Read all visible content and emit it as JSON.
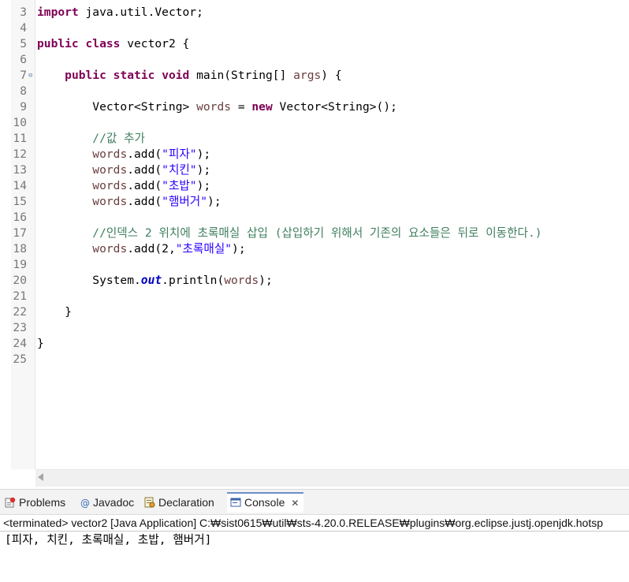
{
  "editor": {
    "lines": [
      {
        "num": "3",
        "tokens": [
          {
            "t": "import",
            "c": "kw"
          },
          {
            "t": " java.util.Vector;"
          }
        ]
      },
      {
        "num": "4",
        "tokens": []
      },
      {
        "num": "5",
        "tokens": [
          {
            "t": "public",
            "c": "kw"
          },
          {
            "t": " "
          },
          {
            "t": "class",
            "c": "kw"
          },
          {
            "t": " vector2 {"
          }
        ]
      },
      {
        "num": "6",
        "tokens": []
      },
      {
        "num": "7",
        "fold": true,
        "tokens": [
          {
            "t": "    "
          },
          {
            "t": "public",
            "c": "kw"
          },
          {
            "t": " "
          },
          {
            "t": "static",
            "c": "kw"
          },
          {
            "t": " "
          },
          {
            "t": "void",
            "c": "kw"
          },
          {
            "t": " main(String[] "
          },
          {
            "t": "args",
            "c": "var"
          },
          {
            "t": ") {"
          }
        ]
      },
      {
        "num": "8",
        "tokens": []
      },
      {
        "num": "9",
        "tokens": [
          {
            "t": "        Vector<String> "
          },
          {
            "t": "words",
            "c": "var"
          },
          {
            "t": " = "
          },
          {
            "t": "new",
            "c": "kw"
          },
          {
            "t": " Vector<String>();"
          }
        ]
      },
      {
        "num": "10",
        "tokens": []
      },
      {
        "num": "11",
        "tokens": [
          {
            "t": "        "
          },
          {
            "t": "//값 추가",
            "c": "cmt"
          }
        ]
      },
      {
        "num": "12",
        "tokens": [
          {
            "t": "        "
          },
          {
            "t": "words",
            "c": "var"
          },
          {
            "t": ".add("
          },
          {
            "t": "\"피자\"",
            "c": "str"
          },
          {
            "t": ");"
          }
        ]
      },
      {
        "num": "13",
        "tokens": [
          {
            "t": "        "
          },
          {
            "t": "words",
            "c": "var"
          },
          {
            "t": ".add("
          },
          {
            "t": "\"치킨\"",
            "c": "str"
          },
          {
            "t": ");"
          }
        ]
      },
      {
        "num": "14",
        "tokens": [
          {
            "t": "        "
          },
          {
            "t": "words",
            "c": "var"
          },
          {
            "t": ".add("
          },
          {
            "t": "\"초밥\"",
            "c": "str"
          },
          {
            "t": ");"
          }
        ]
      },
      {
        "num": "15",
        "tokens": [
          {
            "t": "        "
          },
          {
            "t": "words",
            "c": "var"
          },
          {
            "t": ".add("
          },
          {
            "t": "\"햄버거\"",
            "c": "str"
          },
          {
            "t": ");"
          }
        ]
      },
      {
        "num": "16",
        "tokens": []
      },
      {
        "num": "17",
        "tokens": [
          {
            "t": "        "
          },
          {
            "t": "//인덱스 2 위치에 초록매실 삽입 (삽입하기 위해서 기존의 요소들은 뒤로 이동한다.)",
            "c": "cmt"
          }
        ]
      },
      {
        "num": "18",
        "tokens": [
          {
            "t": "        "
          },
          {
            "t": "words",
            "c": "var"
          },
          {
            "t": ".add(2,"
          },
          {
            "t": "\"초록매실\"",
            "c": "str"
          },
          {
            "t": ");"
          }
        ]
      },
      {
        "num": "19",
        "tokens": []
      },
      {
        "num": "20",
        "tokens": [
          {
            "t": "        System."
          },
          {
            "t": "out",
            "c": "fld"
          },
          {
            "t": ".println("
          },
          {
            "t": "words",
            "c": "var"
          },
          {
            "t": ");"
          }
        ]
      },
      {
        "num": "21",
        "tokens": []
      },
      {
        "num": "22",
        "tokens": [
          {
            "t": "    }"
          }
        ]
      },
      {
        "num": "23",
        "tokens": []
      },
      {
        "num": "24",
        "tokens": [
          {
            "t": "}"
          }
        ]
      },
      {
        "num": "25",
        "tokens": []
      }
    ]
  },
  "console_view": {
    "tabs": [
      {
        "label": "Problems",
        "icon": "problems-icon"
      },
      {
        "label": "Javadoc",
        "icon": "javadoc-icon"
      },
      {
        "label": "Declaration",
        "icon": "declaration-icon"
      },
      {
        "label": "Console",
        "icon": "console-icon",
        "active": true
      }
    ],
    "close_glyph": "✕",
    "status": "<terminated> vector2 [Java Application] C:₩sist0615₩util₩sts-4.20.0.RELEASE₩plugins₩org.eclipse.justj.openjdk.hotsp",
    "output": "[피자, 치킨, 초록매실, 초밥, 햄버거]"
  },
  "colors": {
    "keyword": "#7f0055",
    "string": "#2a00ff",
    "comment": "#3f7f5f",
    "local_variable": "#6a3e3e",
    "static_field": "#0000c0",
    "line_number": "#787878"
  }
}
